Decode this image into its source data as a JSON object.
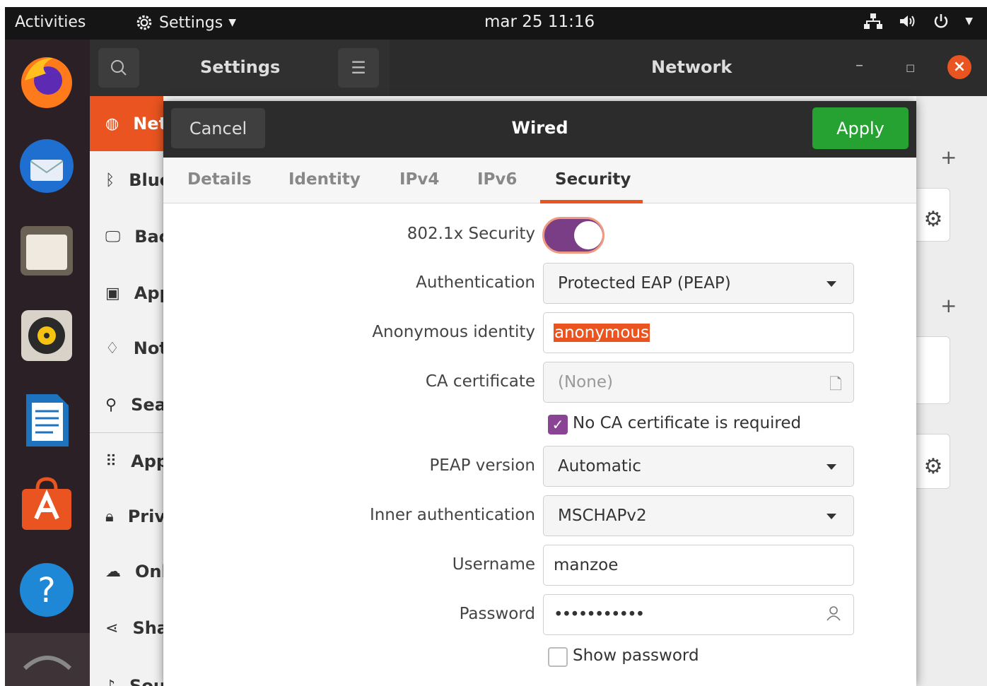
{
  "topbar": {
    "activities": "Activities",
    "app_menu": "Settings",
    "clock": "mar 25  11:16"
  },
  "dock": {
    "items": [
      "firefox",
      "thunderbird",
      "files",
      "rhythmbox",
      "libreoffice-writer",
      "software",
      "help"
    ]
  },
  "settings": {
    "title": "Settings",
    "panel_title": "Network",
    "sidebar": [
      {
        "label": "Network",
        "icon": "network-icon"
      },
      {
        "label": "Bluetooth",
        "icon": "bluetooth-icon"
      },
      {
        "label": "Background",
        "icon": "background-icon"
      },
      {
        "label": "Appearance",
        "icon": "appearance-icon"
      },
      {
        "label": "Notifications",
        "icon": "bell-icon"
      },
      {
        "label": "Search",
        "icon": "search-icon"
      },
      {
        "label": "Applications",
        "icon": "apps-icon"
      },
      {
        "label": "Privacy",
        "icon": "lock-icon"
      },
      {
        "label": "Online Accounts",
        "icon": "cloud-icon"
      },
      {
        "label": "Sharing",
        "icon": "share-icon"
      },
      {
        "label": "Sound",
        "icon": "speaker-icon"
      }
    ]
  },
  "dialog": {
    "cancel": "Cancel",
    "title": "Wired",
    "apply": "Apply",
    "tabs": [
      "Details",
      "Identity",
      "IPv4",
      "IPv6",
      "Security"
    ],
    "active_tab": "Security",
    "security_label": "802.1x Security",
    "security_enabled": true,
    "auth_label": "Authentication",
    "auth_value": "Protected EAP (PEAP)",
    "anon_label": "Anonymous identity",
    "anon_value": "anonymous",
    "ca_label": "CA certificate",
    "ca_value": "(None)",
    "no_ca_label": "No CA certificate is required",
    "no_ca_checked": true,
    "peap_label": "PEAP version",
    "peap_value": "Automatic",
    "inner_label": "Inner authentication",
    "inner_value": "MSCHAPv2",
    "username_label": "Username",
    "username_value": "manzoe",
    "password_label": "Password",
    "password_value": "•••••••••••",
    "show_password_label": "Show password",
    "show_password_checked": false
  },
  "colors": {
    "accent": "#e95420",
    "apply": "#26a232",
    "toggle": "#7a3e87"
  }
}
